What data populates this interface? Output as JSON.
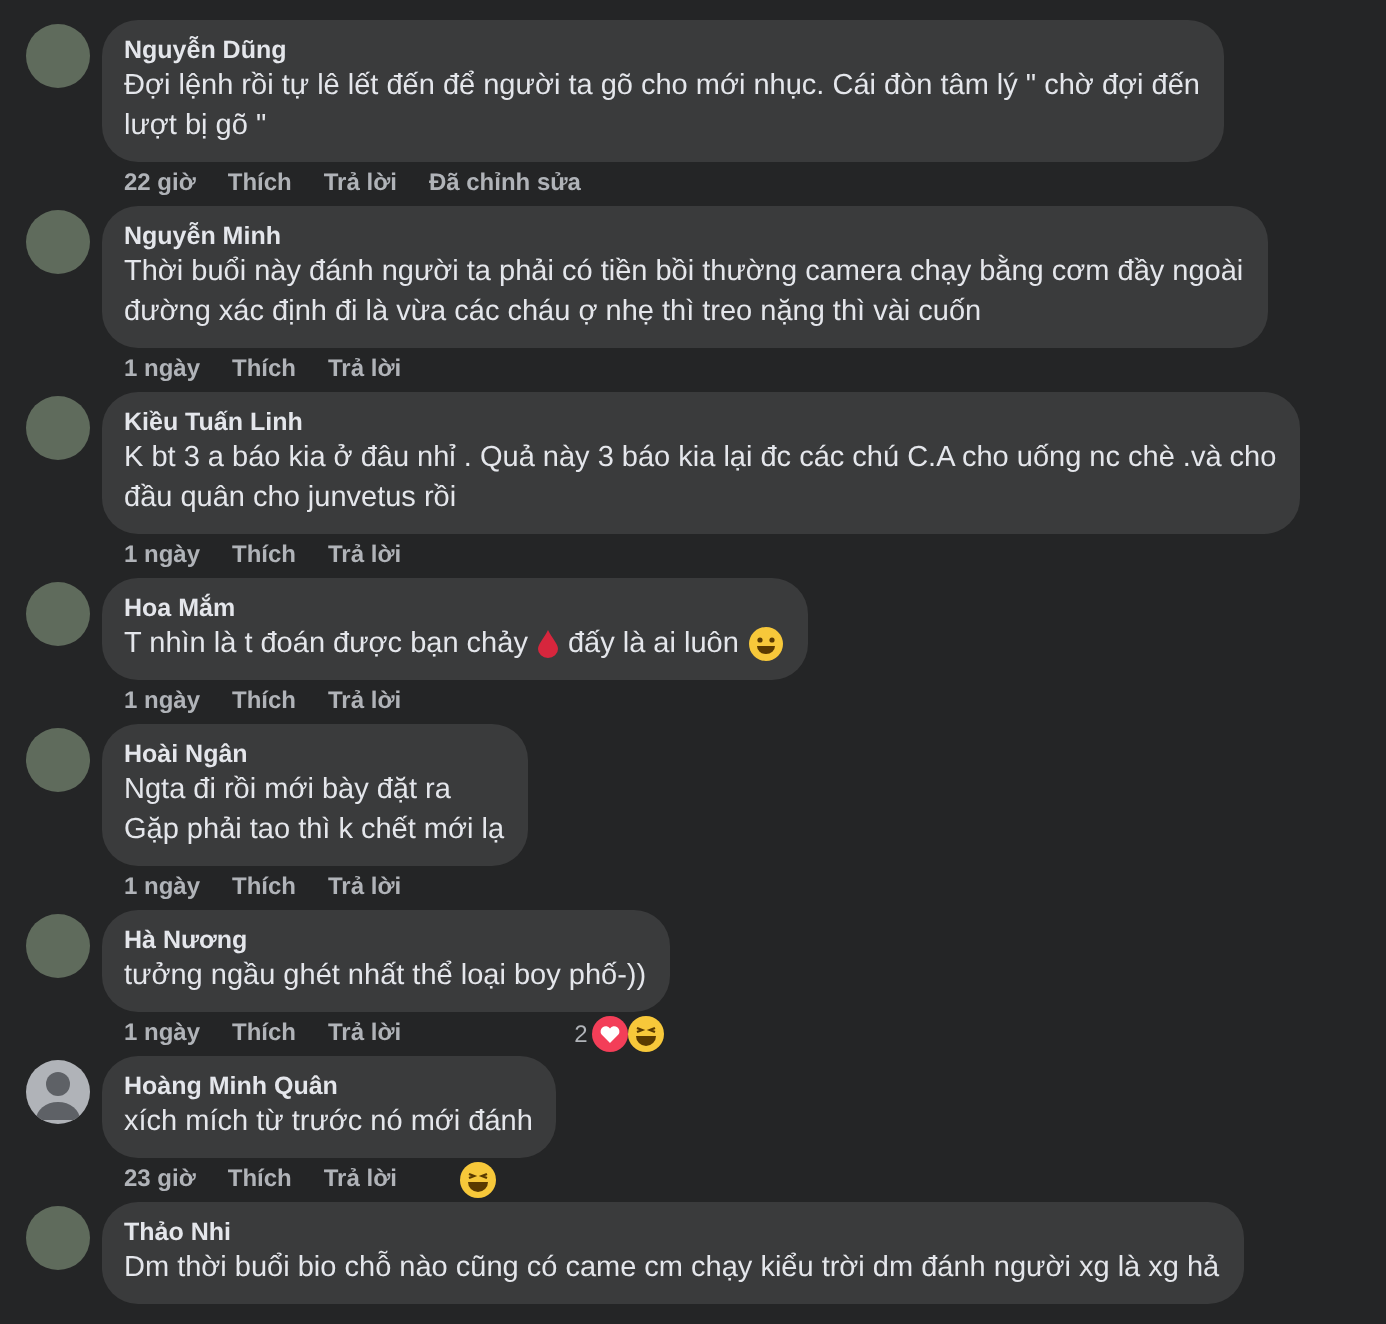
{
  "comments": [
    {
      "author": "Nguyễn Dũng",
      "avatar": {
        "kind": "photo"
      },
      "lines": [
        [
          {
            "kind": "text",
            "text": "Đợi lệnh rồi tự lê lết đến để người ta gõ cho mới nhục. Cái đòn tâm lý \" chờ đợi đến"
          }
        ],
        [
          {
            "kind": "text",
            "text": "lượt bị gõ \""
          }
        ]
      ],
      "time": "22 giờ",
      "actions": [
        "Thích",
        "Trả lời"
      ],
      "edited": "Đã chỉnh sửa"
    },
    {
      "author": "Nguyễn Minh",
      "avatar": {
        "kind": "photo"
      },
      "lines": [
        [
          {
            "kind": "text",
            "text": "Thời buổi này đánh người ta phải có tiền bồi thường camera chạy bằng cơm đầy ngoài"
          }
        ],
        [
          {
            "kind": "text",
            "text": "đường xác định đi là vừa các cháu ợ nhẹ thì treo nặng thì vài cuốn"
          }
        ]
      ],
      "time": "1 ngày",
      "actions": [
        "Thích",
        "Trả lời"
      ]
    },
    {
      "author": "Kiều Tuấn Linh",
      "avatar": {
        "kind": "photo"
      },
      "lines": [
        [
          {
            "kind": "text",
            "text": "K bt 3 a báo kia ở đâu nhỉ . Quả này 3 báo kia lại đc các chú C.A cho uống nc chè .và cho"
          }
        ],
        [
          {
            "kind": "text",
            "text": "đầu quân cho junvetus rồi"
          }
        ]
      ],
      "time": "1 ngày",
      "actions": [
        "Thích",
        "Trả lời"
      ]
    },
    {
      "author": "Hoa Mắm",
      "avatar": {
        "kind": "photo"
      },
      "lines": [
        [
          {
            "kind": "text",
            "text": "T nhìn là t đoán được bạn chảy"
          },
          {
            "kind": "drop"
          },
          {
            "kind": "text",
            "text": "đấy là ai luôn"
          },
          {
            "kind": "smile"
          }
        ]
      ],
      "time": "1 ngày",
      "actions": [
        "Thích",
        "Trả lời"
      ]
    },
    {
      "author": "Hoài Ngân",
      "avatar": {
        "kind": "photo"
      },
      "lines": [
        [
          {
            "kind": "text",
            "text": "Ngta đi rồi mới bày đặt ra"
          }
        ],
        [
          {
            "kind": "text",
            "text": "Gặp phải tao thì k chết mới lạ"
          }
        ]
      ],
      "time": "1 ngày",
      "actions": [
        "Thích",
        "Trả lời"
      ]
    },
    {
      "author": "Hà Nương",
      "avatar": {
        "kind": "photo"
      },
      "lines": [
        [
          {
            "kind": "text",
            "text": "tưởng ngầu ghét nhất thể loại boy phố-))"
          }
        ]
      ],
      "time": "1 ngày",
      "actions": [
        "Thích",
        "Trả lời"
      ],
      "reactions": {
        "count": "2",
        "items": [
          {
            "kind": "love"
          },
          {
            "kind": "haha"
          }
        ]
      }
    },
    {
      "author": "Hoàng Minh Quân",
      "avatar": {
        "kind": "default"
      },
      "lines": [
        [
          {
            "kind": "text",
            "text": "xích mích từ trước nó mới đánh"
          }
        ]
      ],
      "time": "23 giờ",
      "actions": [
        "Thích",
        "Trả lời"
      ],
      "reactions": {
        "items": [
          {
            "kind": "haha"
          }
        ]
      }
    },
    {
      "author": "Thảo Nhi",
      "avatar": {
        "kind": "photo"
      },
      "lines": [
        [
          {
            "kind": "text",
            "text": "Dm thời buổi bio chỗ nào cũng có came cm chạy kiểu trời dm đánh người xg là xg hả"
          }
        ]
      ]
    }
  ]
}
